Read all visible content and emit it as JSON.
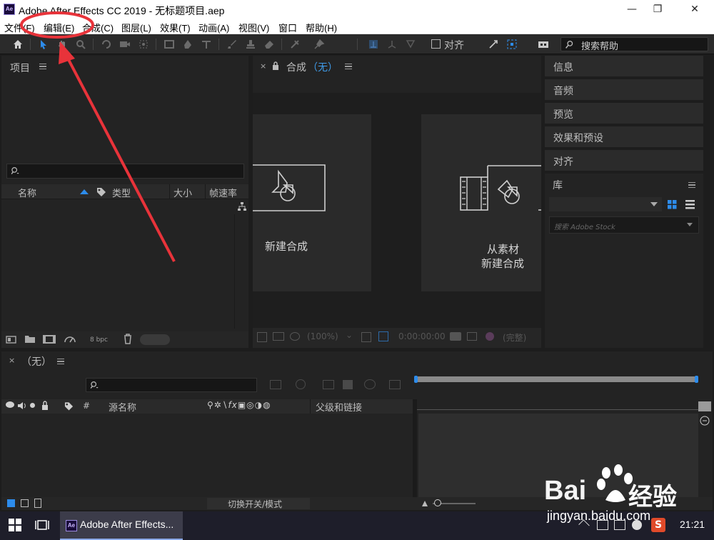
{
  "window": {
    "app_icon": "Ae",
    "title": "Adobe After Effects CC 2019 - 无标题项目.aep",
    "minimize": "—",
    "restore": "❐",
    "close": "✕"
  },
  "menu": [
    "文件(F)",
    "编辑(E)",
    "合成(C)",
    "图层(L)",
    "效果(T)",
    "动画(A)",
    "视图(V)",
    "窗口",
    "帮助(H)"
  ],
  "toolbar": {
    "align_label": "对齐",
    "search_help_placeholder": "搜索帮助"
  },
  "project_panel": {
    "title": "项目",
    "columns": [
      "名称",
      "类型",
      "大小",
      "帧速率"
    ],
    "bpc": "8 bpc"
  },
  "composition_panel": {
    "tab_label": "合成",
    "tab_value": "（无）",
    "new_comp": "新建合成",
    "from_footage_line1": "从素材",
    "from_footage_line2": "新建合成",
    "zoom": "(100%)",
    "timecode": "0:00:00:00",
    "quality": "(完整)"
  },
  "right_panels": [
    "信息",
    "音频",
    "预览",
    "效果和预设",
    "对齐"
  ],
  "library": {
    "title": "库",
    "search_placeholder": "搜索 Adobe Stock"
  },
  "timeline": {
    "tab_label": "（无）",
    "source_name": "源名称",
    "parent_link": "父级和链接",
    "hash": "#",
    "toggle_modes": "切换开关/模式"
  },
  "taskbar": {
    "app_label": "Adobe After Effects...",
    "time": "21:21"
  },
  "watermark": {
    "brand": "Bai",
    "brand_suffix": "经验",
    "url": "jingyan.baidu.com"
  },
  "annotation_color": "#e8333a"
}
